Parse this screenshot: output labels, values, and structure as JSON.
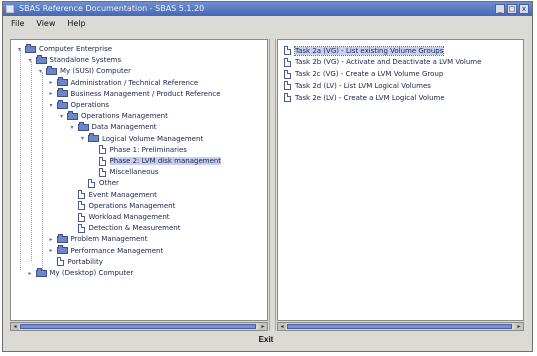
{
  "window": {
    "title": "SBAS Reference Documentation - SBAS 5.1.20",
    "buttons": [
      "_",
      "□",
      "x"
    ]
  },
  "menu": [
    "File",
    "View",
    "Help"
  ],
  "tree": [
    {
      "label": "Computer Enterprise",
      "depth": 0,
      "type": "folder",
      "expanded": true
    },
    {
      "label": "Standalone Systems",
      "depth": 1,
      "type": "folder",
      "expanded": true
    },
    {
      "label": "My (SUSI) Computer",
      "depth": 2,
      "type": "folder",
      "expanded": true
    },
    {
      "label": "Administration / Technical Reference",
      "depth": 3,
      "type": "folder",
      "expanded": false
    },
    {
      "label": "Business Management / Product Reference",
      "depth": 3,
      "type": "folder",
      "expanded": false
    },
    {
      "label": "Operations",
      "depth": 3,
      "type": "folder",
      "expanded": true
    },
    {
      "label": "Operations Management",
      "depth": 4,
      "type": "folder",
      "expanded": true
    },
    {
      "label": "Data Management",
      "depth": 5,
      "type": "folder",
      "expanded": true
    },
    {
      "label": "Logical Volume Management",
      "depth": 6,
      "type": "folder",
      "expanded": true
    },
    {
      "label": "Phase 1: Preliminaries",
      "depth": 7,
      "type": "doc"
    },
    {
      "label": "Phase 2: LVM disk management",
      "depth": 7,
      "type": "doc",
      "selected": true
    },
    {
      "label": "Miscellaneous",
      "depth": 7,
      "type": "doc"
    },
    {
      "label": "Other",
      "depth": 6,
      "type": "doc"
    },
    {
      "label": "Event Management",
      "depth": 5,
      "type": "doc"
    },
    {
      "label": "Operations Management",
      "depth": 5,
      "type": "doc"
    },
    {
      "label": "Workload Management",
      "depth": 5,
      "type": "doc"
    },
    {
      "label": "Detection & Measurement",
      "depth": 5,
      "type": "doc"
    },
    {
      "label": "Problem Management",
      "depth": 3,
      "type": "folder",
      "expanded": false
    },
    {
      "label": "Performance Management",
      "depth": 3,
      "type": "folder",
      "expanded": false
    },
    {
      "label": "Portability",
      "depth": 3,
      "type": "doc"
    },
    {
      "label": "My (Desktop) Computer",
      "depth": 1,
      "type": "folder",
      "expanded": false
    }
  ],
  "list": [
    {
      "label": "Task 2a (VG) - List existing Volume Groups",
      "selected": true
    },
    {
      "label": "Task 2b (VG) - Activate and Deactivate a LVM Volume"
    },
    {
      "label": "Task 2c (VG) - Create a LVM Volume Group"
    },
    {
      "label": "Task 2d (LV) - List LVM Logical Volumes"
    },
    {
      "label": "Task 2e (LV) - Create a LVM Logical Volume"
    }
  ],
  "exit_label": "Exit"
}
